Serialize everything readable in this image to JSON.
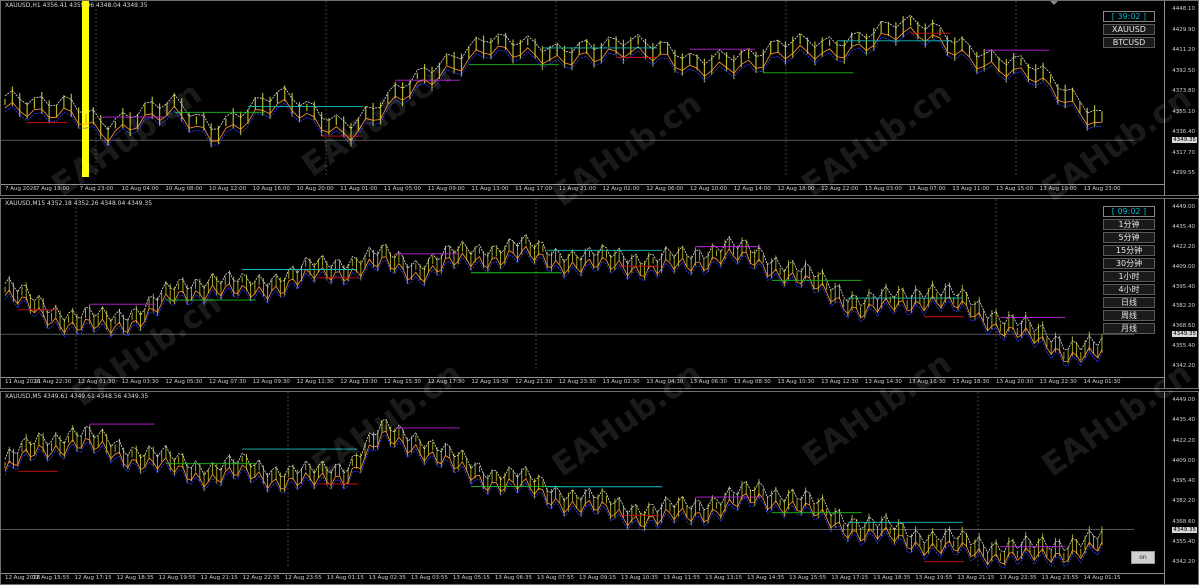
{
  "panes": [
    {
      "id": "h1",
      "title": "XAUUSD,H1  4356.41 4359.06 4348.04 4349.35",
      "y_labels": [
        "4448.10",
        "4429.90",
        "4411.20",
        "4392.50",
        "4373.80",
        "4355.10",
        "4336.40",
        "4317.70",
        "4299.55"
      ],
      "current_price": "4349.35",
      "x_labels": [
        "7 Aug 2026",
        "7 Aug 19:00",
        "7 Aug 23:00",
        "10 Aug 04:00",
        "10 Aug 08:00",
        "10 Aug 12:00",
        "10 Aug 16:00",
        "10 Aug 20:00",
        "11 Aug 01:00",
        "11 Aug 05:00",
        "11 Aug 09:00",
        "11 Aug 13:00",
        "11 Aug 17:00",
        "11 Aug 21:00",
        "12 Aug 02:00",
        "12 Aug 06:00",
        "12 Aug 10:00",
        "12 Aug 14:00",
        "12 Aug 18:00",
        "12 Aug 22:00",
        "13 Aug 03:00",
        "13 Aug 07:00",
        "13 Aug 11:00",
        "13 Aug 15:00",
        "13 Aug 19:00",
        "13 Aug 23:00"
      ],
      "buttons": [
        "[ 39:02 ]",
        "XAUUSD",
        "BTCUSD"
      ]
    },
    {
      "id": "m15",
      "title": "XAUUSD,M15  4352.18 4352.26 4348.04 4349.35",
      "y_labels": [
        "4449.00",
        "4435.40",
        "4422.20",
        "4409.00",
        "4395.40",
        "4382.20",
        "4368.60",
        "4355.40",
        "4342.20"
      ],
      "current_price": "4349.35",
      "x_labels": [
        "11 Aug 2026",
        "11 Aug 22:30",
        "12 Aug 01:30",
        "12 Aug 03:30",
        "12 Aug 05:30",
        "12 Aug 07:30",
        "12 Aug 09:30",
        "12 Aug 11:30",
        "12 Aug 13:30",
        "12 Aug 15:30",
        "12 Aug 17:30",
        "12 Aug 19:30",
        "12 Aug 21:30",
        "12 Aug 23:30",
        "13 Aug 02:30",
        "13 Aug 04:30",
        "13 Aug 06:30",
        "13 Aug 08:30",
        "13 Aug 10:30",
        "13 Aug 12:30",
        "13 Aug 14:30",
        "13 Aug 16:30",
        "13 Aug 18:30",
        "13 Aug 20:30",
        "13 Aug 22:30",
        "14 Aug 01:30"
      ],
      "buttons": [
        "[ 09:02 ]",
        "1分钟",
        "5分钟",
        "15分钟",
        "30分钟",
        "1小时",
        "4小时",
        "日线",
        "周线",
        "月线"
      ]
    },
    {
      "id": "m5",
      "title": "XAUUSD,M5  4349.61 4349.61 4348.56 4349.35",
      "y_labels": [
        "4449.00",
        "4435.40",
        "4422.20",
        "4409.00",
        "4395.40",
        "4382.20",
        "4368.60",
        "4355.40",
        "4342.20"
      ],
      "current_price": "4349.35",
      "x_labels": [
        "12 Aug 2026",
        "12 Aug 15:55",
        "12 Aug 17:15",
        "12 Aug 18:35",
        "12 Aug 19:55",
        "12 Aug 21:15",
        "12 Aug 22:35",
        "12 Aug 23:55",
        "13 Aug 01:15",
        "13 Aug 02:35",
        "13 Aug 03:55",
        "13 Aug 05:15",
        "13 Aug 06:35",
        "13 Aug 07:55",
        "13 Aug 09:15",
        "13 Aug 10:35",
        "13 Aug 11:55",
        "13 Aug 13:15",
        "13 Aug 14:35",
        "13 Aug 15:55",
        "13 Aug 17:15",
        "13 Aug 18:35",
        "13 Aug 19:55",
        "13 Aug 21:15",
        "13 Aug 22:35",
        "13 Aug 23:55",
        "14 Aug 01:15"
      ],
      "on_button": "on"
    }
  ],
  "watermark": "EAHub.cn",
  "colors": {
    "background": "#000000",
    "candle": "#b5b52a",
    "grid": "#6a6a6a",
    "highlight": "#ffff00",
    "timer": "#00bcd4",
    "ma_blue": "#2a3cff",
    "ma_orange": "#ff9a3c",
    "ma_white": "#e0e0e0",
    "level_red": "#d01010",
    "level_magenta": "#c020e0",
    "level_green": "#18c018",
    "level_cyan": "#10c0c0"
  }
}
